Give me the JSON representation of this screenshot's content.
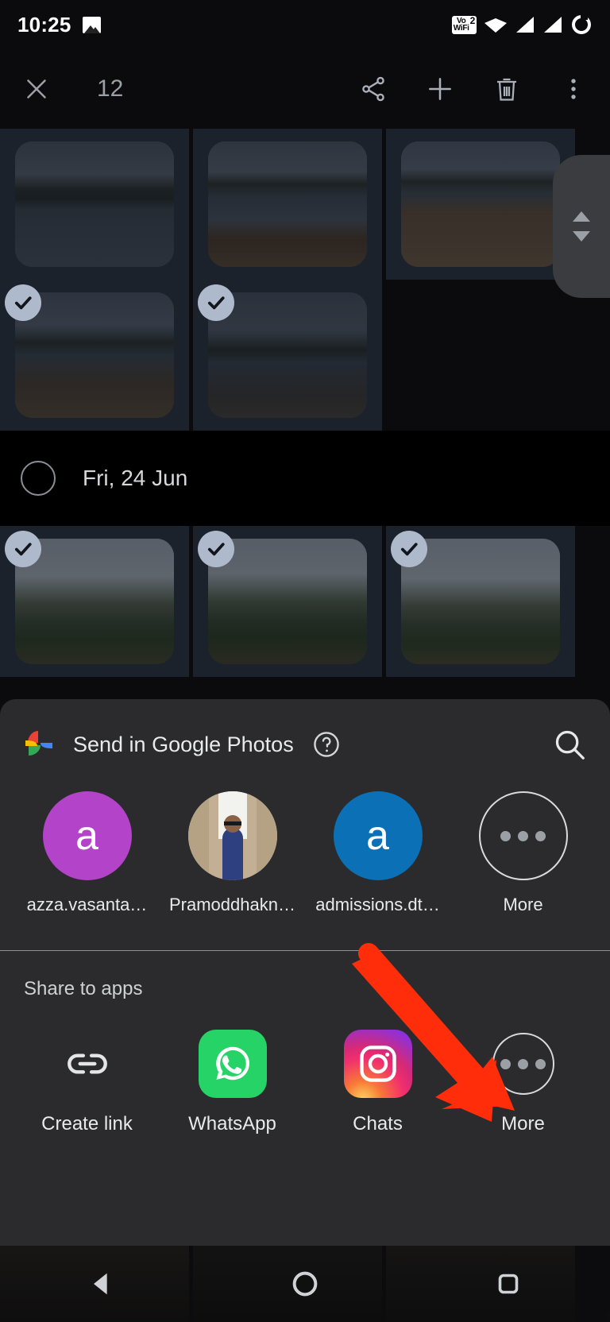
{
  "status_bar": {
    "time": "10:25",
    "icons": [
      "photo-icon",
      "volte-wifi-icon",
      "wifi-icon",
      "signal-1-icon",
      "signal-2-icon",
      "battery-icon"
    ],
    "volte_label": "Vo",
    "volte_sub": "WiFi",
    "volte_sim": "2"
  },
  "toolbar": {
    "close_label": "close-icon",
    "selection_count": "12",
    "actions": [
      {
        "name": "share-button",
        "icon": "share-icon"
      },
      {
        "name": "add-button",
        "icon": "plus-icon"
      },
      {
        "name": "delete-button",
        "icon": "trash-icon"
      },
      {
        "name": "overflow-button",
        "icon": "more-vertical-icon"
      }
    ]
  },
  "grid": {
    "rows": [
      {
        "cells": [
          {
            "name": "photo-tile",
            "selected": false,
            "style": "ph-lake1"
          },
          {
            "name": "photo-tile",
            "selected": false,
            "style": "ph-lake2"
          },
          {
            "name": "photo-tile",
            "selected": false,
            "style": "ph-lake3"
          }
        ]
      },
      {
        "cells": [
          {
            "name": "photo-tile",
            "selected": true,
            "style": "ph-lake4"
          },
          {
            "name": "photo-tile",
            "selected": true,
            "style": "ph-lake5"
          }
        ]
      }
    ],
    "date_header": {
      "label": "Fri, 24 Jun",
      "selected": false
    },
    "rows_after": [
      {
        "cells": [
          {
            "name": "photo-tile",
            "selected": true,
            "style": "ph-hill1"
          },
          {
            "name": "photo-tile",
            "selected": true,
            "style": "ph-hill2"
          },
          {
            "name": "photo-tile",
            "selected": true,
            "style": "ph-hill3"
          }
        ]
      }
    ],
    "scrollbar": "fast-scroll-thumb"
  },
  "share_sheet": {
    "app_name": "Send in Google Photos",
    "help_icon": "help-circle-icon",
    "search_icon": "search-icon",
    "contacts": [
      {
        "label": "azza.vasanta…",
        "avatar_type": "letter",
        "letter": "a",
        "color": "#b343c8"
      },
      {
        "label": "Pramoddhakn…",
        "avatar_type": "photo",
        "letter": "",
        "color": "#8c7a5e"
      },
      {
        "label": "admissions.dt…",
        "avatar_type": "letter",
        "letter": "a",
        "color": "#0b70b5"
      },
      {
        "label": "More",
        "avatar_type": "more",
        "letter": "",
        "color": "transparent"
      }
    ],
    "apps_section_title": "Share to apps",
    "apps": [
      {
        "label": "Create link",
        "icon": "link-icon"
      },
      {
        "label": "WhatsApp",
        "icon": "whatsapp-icon"
      },
      {
        "label": "Chats",
        "icon": "instagram-icon"
      },
      {
        "label": "More",
        "icon": "more-horizontal-icon"
      }
    ]
  },
  "annotation": {
    "arrow_color": "#FF2D0A",
    "points_to": "share-to-apps-more-button"
  },
  "nav_bar": {
    "back": "back-triangle-icon",
    "home": "home-circle-icon",
    "recents": "recents-square-icon"
  },
  "colors": {
    "sheet_bg": "#2b2b2d",
    "app_bg": "#0b0b0d",
    "tile_bg": "#1b222c",
    "check_circle": "#aebacb",
    "accent_red": "#FF2D0A"
  }
}
